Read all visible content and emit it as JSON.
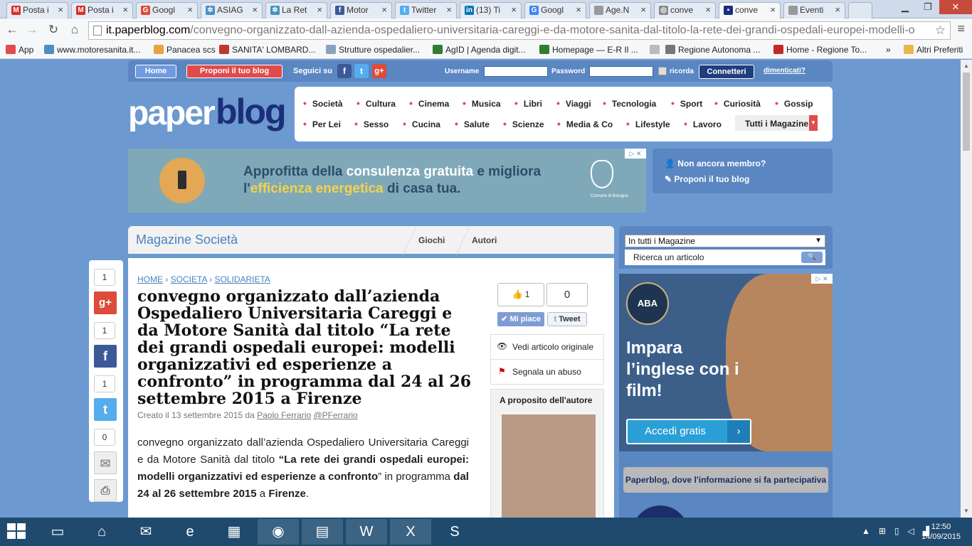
{
  "browser": {
    "tabs": [
      {
        "title": "Posta i",
        "icon": "gmail-icon",
        "color": "#d93025",
        "glyph": "M"
      },
      {
        "title": "Posta i",
        "icon": "gmail-icon",
        "color": "#d93025",
        "glyph": "M"
      },
      {
        "title": "Googl",
        "icon": "google-plus-icon",
        "color": "#dd4b39",
        "glyph": "G"
      },
      {
        "title": "ASIAG",
        "icon": "globe-icon",
        "color": "#4a90c5",
        "glyph": "✲"
      },
      {
        "title": "La Ret",
        "icon": "globe-icon",
        "color": "#4a90c5",
        "glyph": "✲"
      },
      {
        "title": "Motor",
        "icon": "facebook-icon",
        "color": "#3b5998",
        "glyph": "f"
      },
      {
        "title": "Twitter",
        "icon": "twitter-icon",
        "color": "#55acee",
        "glyph": "t"
      },
      {
        "title": "(13) Ti",
        "icon": "linkedin-icon",
        "color": "#0077b5",
        "glyph": "in"
      },
      {
        "title": "Googl",
        "icon": "google-icon",
        "color": "#4285f4",
        "glyph": "G"
      },
      {
        "title": "Age.N",
        "icon": "page-icon",
        "color": "#999999",
        "glyph": ""
      },
      {
        "title": "conve",
        "icon": "globe-icon",
        "color": "#888888",
        "glyph": "◎"
      },
      {
        "title": "conve",
        "icon": "paperblog-icon",
        "color": "#1c2e7a",
        "glyph": "▪"
      },
      {
        "title": "Eventi",
        "icon": "page-icon",
        "color": "#999999",
        "glyph": ""
      }
    ],
    "active_tab": 11,
    "url_host": "it.paperblog.com",
    "url_path": "/convegno-organizzato-dall-azienda-ospedaliero-universitaria-careggi-e-da-motore-sanita-dal-titolo-la-rete-dei-grandi-ospedali-europei-modelli-o",
    "bookmarks": [
      {
        "label": "App",
        "icon": "apps-icon",
        "color": "#e04b4b"
      },
      {
        "label": "www.motoresanita.it...",
        "icon": "globe-icon",
        "color": "#4a90c5"
      },
      {
        "label": "Panacea scs",
        "icon": "panacea-icon",
        "color": "#e8a33d"
      },
      {
        "label": "SANITA' LOMBARD...",
        "icon": "lombardia-icon",
        "color": "#c0392b"
      },
      {
        "label": "Strutture ospedalier...",
        "icon": "page-icon",
        "color": "#8aa2c0"
      },
      {
        "label": "AgID | Agenda digit...",
        "icon": "agid-icon",
        "color": "#2e7d32"
      },
      {
        "label": "Homepage — E-R Il ...",
        "icon": "er-icon",
        "color": "#2e7d32"
      },
      {
        "label": "",
        "icon": "page-icon",
        "color": "#bbbbbb"
      },
      {
        "label": "Regione Autonoma ...",
        "icon": "sardegna-icon",
        "color": "#777777"
      },
      {
        "label": "Home - Regione To...",
        "icon": "toscana-icon",
        "color": "#c62828"
      },
      {
        "label": "»",
        "icon": "",
        "color": ""
      },
      {
        "label": "Altri Preferiti",
        "icon": "folder-icon",
        "color": "#e8b84a"
      }
    ]
  },
  "topbar": {
    "home": "Home",
    "propose": "Proponi il tuo blog",
    "follow": "Seguici su",
    "username_label": "Username",
    "password_label": "Password",
    "remember": "ricorda",
    "connect": "Connetteri",
    "forgot": "dimenticati?"
  },
  "logo": {
    "part1": "paper",
    "part2": "blog"
  },
  "categories_row1": [
    "Società",
    "Cultura",
    "Cinema",
    "Musica",
    "Libri",
    "Viaggi",
    "Tecnologia",
    "Sport",
    "Curiosità",
    "Gossip"
  ],
  "categories_row2": [
    "Per Lei",
    "Sesso",
    "Cucina",
    "Salute",
    "Scienze",
    "Media & Co",
    "Lifestyle",
    "Lavoro"
  ],
  "all_magazines": "Tutti i Magazine",
  "ad1": {
    "line1_a": "Approfitta della ",
    "line1_b": "consulenza gratuita",
    "line1_c": " e migliora",
    "line2_a": "l'",
    "line2_b": "efficienza energetica",
    "line2_c": " di casa tua.",
    "city": "Comune di Bologna"
  },
  "member": {
    "not_member": "Non ancora membro?",
    "propose": "Proponi il tuo blog"
  },
  "magazine": {
    "title": "Magazine Società",
    "tabs": [
      "Giochi",
      "Autori"
    ]
  },
  "share": {
    "counts": [
      "1",
      "1",
      "1",
      "0"
    ]
  },
  "article": {
    "breadcrumb": [
      "HOME",
      "SOCIETA",
      "SOLIDARIETA"
    ],
    "title": "convegno organizzato dall’azienda Ospedaliero Universitaria Careggi e da Motore Sanità dal titolo “La rete dei grandi ospedali europei: modelli organizzativi ed esperienze a confronto” in programma dal 24 al 26 settembre 2015 a Firenze",
    "created": "Creato il 13 settembre 2015 da ",
    "author": "Paolo Ferrario",
    "handle": "@PFerrario",
    "body_1": "convegno organizzato dall’azienda Ospedaliero Universitaria Careggi  e da Motore Sanità dal titolo ",
    "body_2": "“La rete dei grandi ospedali europei: modelli organizzativi ed esperienze a confronto",
    "body_3": "” in programma ",
    "body_4": "dal 24 al 26 settembre 2015",
    "body_5": " a ",
    "body_6": "Firenze",
    "body_7": "."
  },
  "social": {
    "likes": "1",
    "tweets": "0",
    "like_btn": "Mi piace",
    "tweet_btn": "Tweet"
  },
  "actions": {
    "view_original": "Vedi articolo originale",
    "report": "Segnala un abuso"
  },
  "author_box": {
    "title": "A proposito dell'autore"
  },
  "search": {
    "select": "In tutti i Magazine",
    "placeholder": "Ricerca un articolo"
  },
  "ad2": {
    "badge": "ABA",
    "headline": "Impara l’inglese con i film!",
    "cta": "Accedi gratis"
  },
  "paperblog_tagline": "Paperblog, dove l'informazione si fa partecipativa",
  "clock": {
    "time": "12:50",
    "date": "14/09/2015"
  }
}
